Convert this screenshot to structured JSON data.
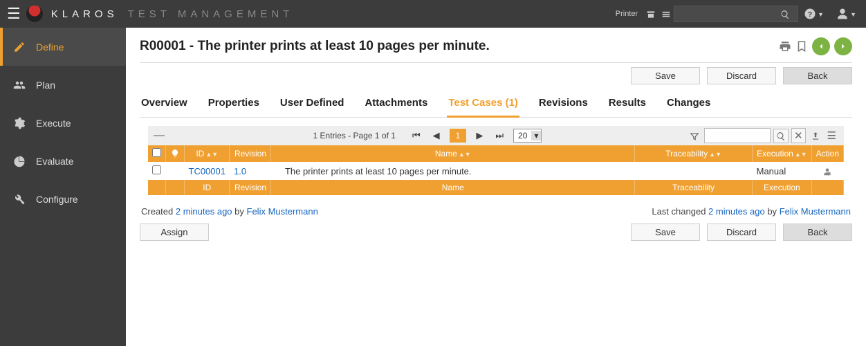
{
  "brand": {
    "main": "KLAROS",
    "sub": "TEST MANAGEMENT"
  },
  "context": {
    "label": "Printer"
  },
  "sidebar": {
    "items": [
      {
        "label": "Define"
      },
      {
        "label": "Plan"
      },
      {
        "label": "Execute"
      },
      {
        "label": "Evaluate"
      },
      {
        "label": "Configure"
      }
    ]
  },
  "page": {
    "title": "R00001 - The printer prints at least 10 pages per minute."
  },
  "actions": {
    "save": "Save",
    "discard": "Discard",
    "back": "Back",
    "assign": "Assign"
  },
  "tabs": [
    {
      "label": "Overview"
    },
    {
      "label": "Properties"
    },
    {
      "label": "User Defined"
    },
    {
      "label": "Attachments"
    },
    {
      "label": "Test Cases (1)",
      "active": true
    },
    {
      "label": "Revisions"
    },
    {
      "label": "Results"
    },
    {
      "label": "Changes"
    }
  ],
  "pager": {
    "summary": "1 Entries - Page 1 of 1",
    "current": "1",
    "page_size": "20"
  },
  "columns": {
    "id": "ID",
    "revision": "Revision",
    "name": "Name",
    "traceability": "Traceability",
    "execution": "Execution",
    "action": "Action"
  },
  "rows": [
    {
      "id": "TC00001",
      "revision": "1.0",
      "name": "The printer prints at least 10 pages per minute.",
      "execution": "Manual"
    }
  ],
  "meta": {
    "created_prefix": "Created ",
    "created_time": "2 minutes ago",
    "created_by_prefix": " by ",
    "created_by": "Felix Mustermann",
    "changed_prefix": "Last changed ",
    "changed_time": "2 minutes ago",
    "changed_by_prefix": " by ",
    "changed_by": "Felix Mustermann"
  }
}
